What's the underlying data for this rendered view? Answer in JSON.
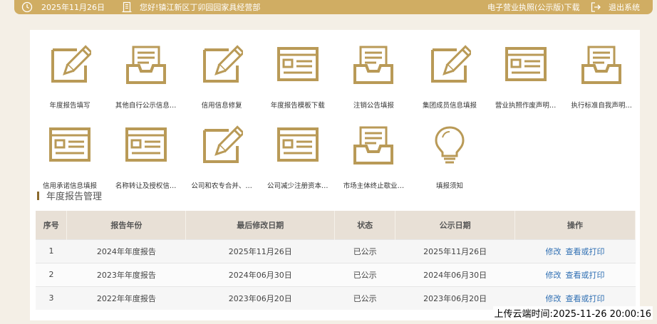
{
  "colors": {
    "gold": "#d0ad63",
    "icon_gold": "#b99a57",
    "link": "#2f6fb3"
  },
  "header": {
    "date": "2025年11月26日",
    "greeting": "您好!镇江新区丁卯园园家具经营部",
    "license_download": "电子营业执照(公示版)下载",
    "logout": "退出系统"
  },
  "tiles": [
    {
      "label": "年度报告填写",
      "icon": "pencil-icon"
    },
    {
      "label": "其他自行公示信息…",
      "icon": "inbox-icon"
    },
    {
      "label": "信用信息修复",
      "icon": "pencil-icon"
    },
    {
      "label": "年度报告模板下载",
      "icon": "form-icon"
    },
    {
      "label": "注销公告填报",
      "icon": "inbox-icon"
    },
    {
      "label": "集团成员信息填报",
      "icon": "pencil-icon"
    },
    {
      "label": "营业执照作废声明…",
      "icon": "form-icon"
    },
    {
      "label": "执行标准自我声明…",
      "icon": "inbox-icon"
    },
    {
      "label": "信用承诺信息填报",
      "icon": "form-icon"
    },
    {
      "label": "名称转让及授权信…",
      "icon": "form-icon"
    },
    {
      "label": "公司和农专合并、…",
      "icon": "pencil-icon"
    },
    {
      "label": "公司减少注册资本…",
      "icon": "form-icon"
    },
    {
      "label": "市场主体终止歇业…",
      "icon": "inbox-icon"
    },
    {
      "label": "填报须知",
      "icon": "lightbulb-icon"
    }
  ],
  "section": {
    "title": "年度报告管理"
  },
  "table": {
    "headers": [
      "序号",
      "报告年份",
      "最后修改日期",
      "状态",
      "公示日期",
      "操作"
    ],
    "rows": [
      {
        "index": "1",
        "year": "2024年年度报告",
        "modified": "2025年11月26日",
        "status": "已公示",
        "published": "2025年11月26日",
        "edit": "修改",
        "view": "查看或打印"
      },
      {
        "index": "2",
        "year": "2023年年度报告",
        "modified": "2024年06月30日",
        "status": "已公示",
        "published": "2024年06月30日",
        "edit": "修改",
        "view": "查看或打印"
      },
      {
        "index": "3",
        "year": "2022年年度报告",
        "modified": "2023年06月20日",
        "status": "已公示",
        "published": "2023年06月20日",
        "edit": "修改",
        "view": "查看或打印"
      }
    ]
  },
  "watermark": "上传云端时间:2025-11-26 20:00:16"
}
